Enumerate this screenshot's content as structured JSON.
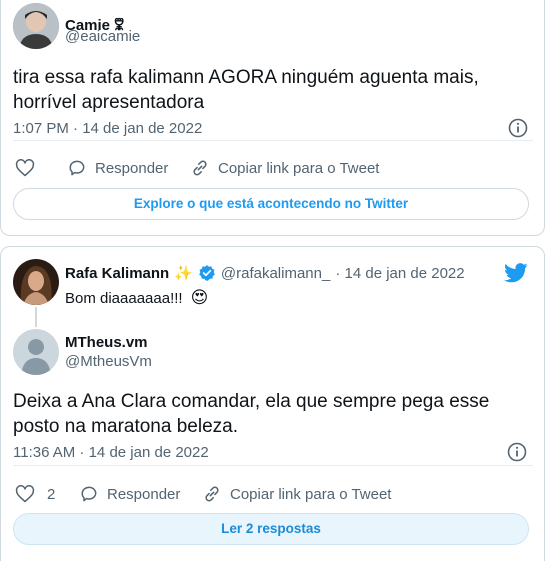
{
  "tweet1": {
    "author_name": "Camie 🜟",
    "author_handle": "@eaicamie",
    "text": "tira essa rafa kalimann AGORA ninguém aguenta mais, horrível apresentadora",
    "timestamp": "1:07 PM · 14 de jan de 2022",
    "actions": {
      "reply": "Responder",
      "copy": "Copiar link para o Tweet"
    },
    "explore_label": "Explore o que está acontecendo no Twitter"
  },
  "tweet2": {
    "parent": {
      "author_name": "Rafa Kalimann",
      "name_emoji": "✨",
      "author_handle": "@rafakalimann_",
      "date": "· 14 de jan de 2022",
      "text": "Bom diaaaaaaa!!!",
      "text_emoji": "😍"
    },
    "reply": {
      "author_name": "MTheus.vm",
      "author_handle": "@MtheusVm",
      "text": "Deixa a Ana Clara comandar, ela que sempre pega esse posto na maratona beleza.",
      "timestamp": "11:36 AM · 14 de jan de 2022",
      "like_count": "2",
      "actions": {
        "reply": "Responder",
        "copy": "Copiar link para o Tweet"
      },
      "read_replies_label": "Ler 2 respostas"
    }
  },
  "colors": {
    "accent": "#1d9bf0",
    "text": "#0f1419",
    "muted": "#536471",
    "border": "#cfd9de",
    "verified": "#1d9bf0"
  }
}
